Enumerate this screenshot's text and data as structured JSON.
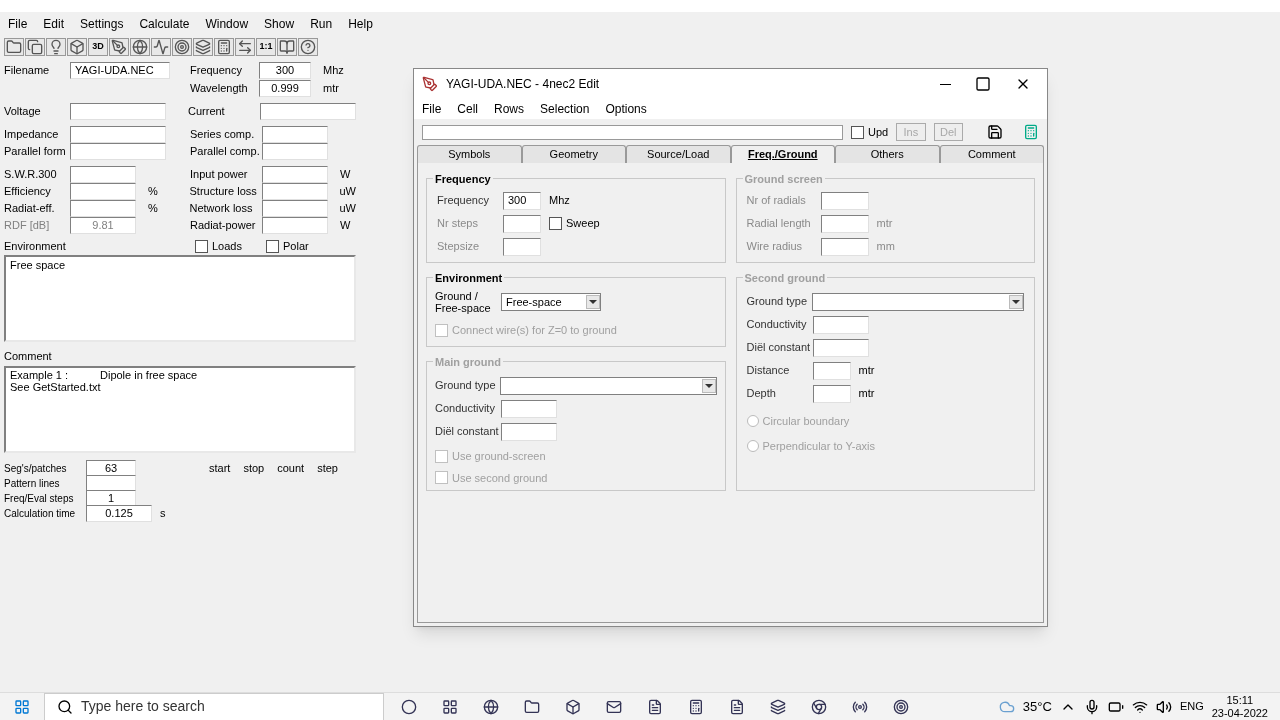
{
  "main": {
    "menu": [
      "File",
      "Edit",
      "Settings",
      "Calculate",
      "Window",
      "Show",
      "Run",
      "Help"
    ],
    "toolbar_labels": [
      "3D",
      "1:1"
    ],
    "filename": {
      "label": "Filename",
      "value": "YAGI-UDA.NEC"
    },
    "frequency": {
      "label": "Frequency",
      "value": "300",
      "unit": "Mhz"
    },
    "wavelength": {
      "label": "Wavelength",
      "value": "0.999",
      "unit": "mtr"
    },
    "groups": [
      [
        {
          "left": {
            "label": "Voltage"
          },
          "right": {
            "label": "Current"
          }
        }
      ],
      [
        {
          "left": {
            "label": "Impedance"
          },
          "right": {
            "label": "Series comp."
          }
        },
        {
          "left": {
            "label": "Parallel form"
          },
          "right": {
            "label": "Parallel comp."
          }
        }
      ],
      [
        {
          "left": {
            "label": "S.W.R.300"
          },
          "right": {
            "label": "Input power",
            "unit": "W"
          }
        },
        {
          "left": {
            "label": "Efficiency",
            "unit": "%"
          },
          "right": {
            "label": "Structure loss",
            "unit": "uW"
          }
        },
        {
          "left": {
            "label": "Radiat-eff.",
            "unit": "%"
          },
          "right": {
            "label": "Network loss",
            "unit": "uW"
          }
        },
        {
          "left": {
            "label": "RDF [dB]",
            "value": "9.81",
            "disabled": true
          },
          "right": {
            "label": "Radiat-power",
            "unit": "W"
          }
        }
      ]
    ],
    "environment": {
      "label": "Environment",
      "checkboxes": [
        {
          "label": "Loads",
          "checked": false
        },
        {
          "label": "Polar",
          "checked": false
        }
      ],
      "text": "Free space"
    },
    "comment": {
      "label": "Comment",
      "lines": [
        [
          "Example 1 :",
          "Dipole in free space"
        ],
        [
          "See GetStarted.txt"
        ]
      ]
    },
    "sweep_headers": [
      "start",
      "stop",
      "count",
      "step"
    ],
    "stats": [
      {
        "label": "Seg's/patches",
        "value": "63"
      },
      {
        "label": "Pattern lines"
      },
      {
        "label": "Freq/Eval steps",
        "value": "1"
      },
      {
        "label": "Calculation time",
        "value": "0.125",
        "unit": "s"
      }
    ]
  },
  "editor": {
    "title": "YAGI-UDA.NEC - 4nec2 Edit",
    "menu": [
      "File",
      "Cell",
      "Rows",
      "Selection",
      "Options"
    ],
    "upd": {
      "label": "Upd",
      "checked": false
    },
    "buttons": [
      {
        "label": "Ins",
        "disabled": true
      },
      {
        "label": "Del",
        "disabled": true
      }
    ],
    "tabs": [
      {
        "label": "Symbols",
        "selected": false
      },
      {
        "label": "Geometry",
        "selected": false
      },
      {
        "label": "Source/Load",
        "selected": false
      },
      {
        "label": "Freq./Ground",
        "selected": true
      },
      {
        "label": "Others",
        "selected": false
      },
      {
        "label": "Comment",
        "selected": false
      }
    ],
    "frequency": {
      "title": "Frequency",
      "disabled": false,
      "fields": [
        {
          "label": "Frequency",
          "value": "300",
          "unit": "Mhz",
          "disabled": false
        },
        {
          "label": "Nr steps",
          "disabled": true
        },
        {
          "label": "Stepsize",
          "disabled": true
        }
      ],
      "sweep": {
        "label": "Sweep",
        "checked": false
      }
    },
    "ground_screen": {
      "title": "Ground screen",
      "disabled": true,
      "fields": [
        {
          "label": "Nr of radials",
          "disabled": true
        },
        {
          "label": "Radial length",
          "unit": "mtr",
          "disabled": true
        },
        {
          "label": "Wire radius",
          "unit": "mm",
          "disabled": true
        }
      ]
    },
    "environment": {
      "title": "Environment",
      "disabled": false,
      "label": "Ground / Free-space",
      "value": "Free-space",
      "connect": {
        "label": "Connect wire(s) for Z=0 to ground",
        "checked": false,
        "disabled": true
      }
    },
    "main_ground": {
      "title": "Main ground",
      "disabled": true,
      "type_label": "Ground type",
      "fields": [
        {
          "label": "Conductivity",
          "disabled": false
        },
        {
          "label": "Diël constant",
          "disabled": false
        }
      ],
      "checkboxes": [
        {
          "label": "Use ground-screen",
          "checked": false,
          "disabled": true
        },
        {
          "label": "Use second ground",
          "checked": false,
          "disabled": true
        }
      ]
    },
    "second_ground": {
      "title": "Second ground",
      "disabled": true,
      "type_label": "Ground type",
      "fields": [
        {
          "label": "Conductivity",
          "disabled": false
        },
        {
          "label": "Diël constant",
          "disabled": false
        },
        {
          "label": "Distance",
          "unit": "mtr",
          "disabled": false
        },
        {
          "label": "Depth",
          "unit": "mtr",
          "disabled": false
        }
      ],
      "radios": [
        {
          "label": "Circular boundary",
          "selected": false,
          "disabled": true
        },
        {
          "label": "Perpendicular to Y-axis",
          "selected": false,
          "disabled": true
        }
      ]
    }
  },
  "taskbar": {
    "search": {
      "placeholder": "Type here to search"
    },
    "weather": "35°C",
    "language": "ENG",
    "time": "15:11",
    "date": "23-04-2022"
  }
}
